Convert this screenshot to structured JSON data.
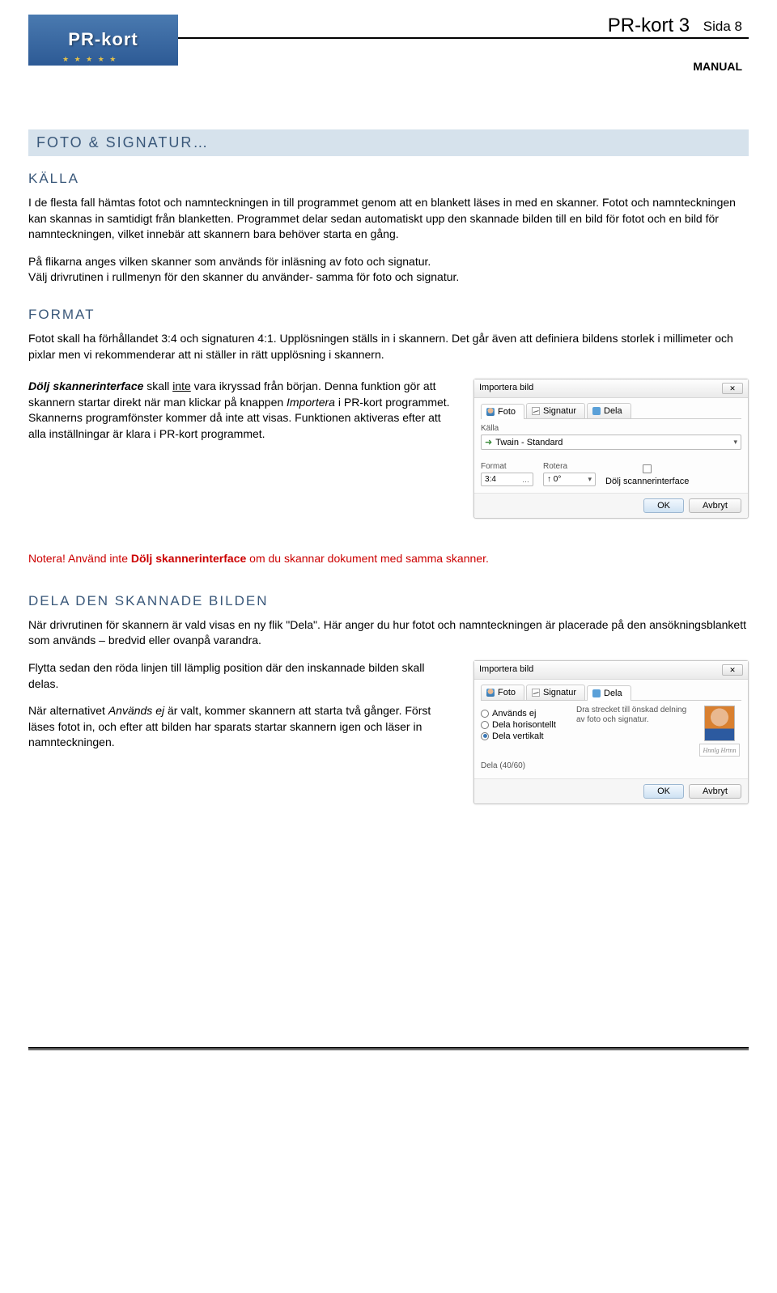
{
  "header": {
    "logo_text": "PR-kort",
    "product": "PR-kort 3",
    "page_label": "Sida 8",
    "manual": "MANUAL"
  },
  "section_head": "FOTO & SIGNATUR…",
  "h_kalla": "KÄLLA",
  "p_kalla1": "I de flesta fall hämtas fotot och namnteckningen in till programmet genom att en blankett läses in med en skanner. Fotot och namnteckningen kan skannas in samtidigt från blanketten. Programmet delar sedan automatiskt upp den skannade bilden till en bild för fotot och en bild för namnteckningen, vilket innebär att skannern bara behöver starta en gång.",
  "p_kalla2": "På flikarna anges vilken skanner som används för inläsning av foto och signatur.\nVälj drivrutinen i rullmenyn för den skanner du använder- samma för foto och signatur.",
  "h_format": "FORMAT",
  "p_format": "Fotot skall ha förhållandet 3:4 och signaturen 4:1. Upplösningen ställs in i skannern. Det går även att definiera bildens storlek i millimeter och pixlar men vi rekommenderar att ni ställer in rätt upplösning i skannern.",
  "p_dolj_1a": "Dölj skannerinterface",
  "p_dolj_1b": " skall ",
  "p_dolj_1c": "inte",
  "p_dolj_1d": " vara ikryssad från början. Denna funktion gör att skannern startar direkt när man klickar på knappen ",
  "p_dolj_1e": "Importera",
  "p_dolj_1f": " i PR-kort programmet. Skannerns programfönster kommer då inte att visas. Funktionen aktiveras efter att alla inställningar är klara i PR-kort programmet.",
  "note_red_a": "Notera!",
  "note_red_b": " Använd inte ",
  "note_red_c": "Dölj skannerinterface",
  "note_red_d": " om du skannar dokument med samma skanner.",
  "h_dela": "DELA DEN SKANNADE BILDEN",
  "p_dela1": "När drivrutinen för skannern är vald visas en ny flik \"Dela\". Här anger du hur fotot och namnteckningen är placerade på den ansökningsblankett som används – bredvid eller ovanpå varandra.",
  "p_dela2": "Flytta sedan den röda linjen till lämplig position där den inskannade bilden skall delas.",
  "p_dela3a": "När alternativet ",
  "p_dela3b": "Används ej",
  "p_dela3c": " är valt, kommer skannern att starta två gånger. Först läses fotot in, och efter att bilden har sparats startar skannern igen och läser in namnteckningen.",
  "dlg1": {
    "title": "Importera bild",
    "tabs": {
      "foto": "Foto",
      "signatur": "Signatur",
      "dela": "Dela"
    },
    "kalla_lbl": "Källa",
    "kalla_val": "Twain - Standard",
    "format_lbl": "Format",
    "format_val": "3:4",
    "rotera_lbl": "Rotera",
    "rotera_val": "0°",
    "chk": "Dölj scannerinterface",
    "ok": "OK",
    "cancel": "Avbryt"
  },
  "dlg2": {
    "title": "Importera bild",
    "tabs": {
      "foto": "Foto",
      "signatur": "Signatur",
      "dela": "Dela"
    },
    "r1": "Används ej",
    "r2": "Dela horisontellt",
    "r3": "Dela vertikalt",
    "desc": "Dra strecket till önskad delning av foto och signatur.",
    "field_lbl": "Dela (40/60)",
    "ok": "OK",
    "cancel": "Avbryt"
  }
}
